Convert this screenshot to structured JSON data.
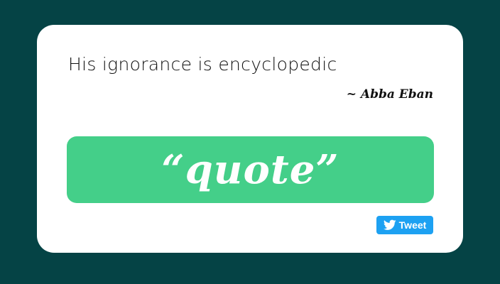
{
  "quote": {
    "text": "His ignorance is encyclopedic",
    "author": "~ Abba Eban"
  },
  "buttons": {
    "new_quote_label": "“quote”",
    "tweet_label": "Tweet",
    "tweet_icon": "twitter-bird-icon"
  },
  "colors": {
    "background": "#054345",
    "card": "#ffffff",
    "quote_button": "#44cf89",
    "tweet_button": "#1da1f2"
  }
}
